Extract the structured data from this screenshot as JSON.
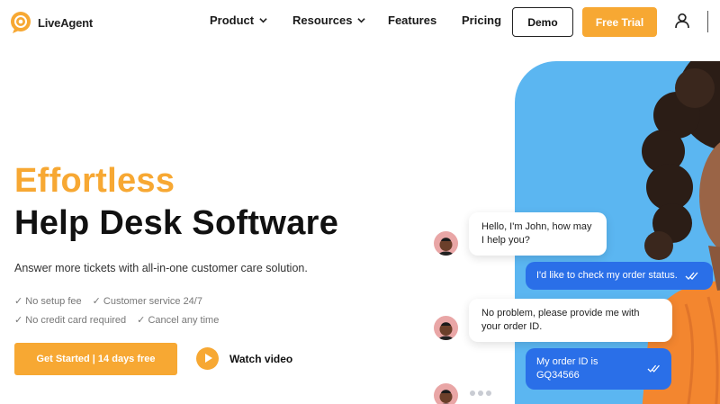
{
  "header": {
    "logo_text": "LiveAgent",
    "nav": [
      {
        "label": "Product",
        "has_dropdown": true
      },
      {
        "label": "Resources",
        "has_dropdown": true
      },
      {
        "label": "Features",
        "has_dropdown": false
      },
      {
        "label": "Pricing",
        "has_dropdown": false
      }
    ],
    "demo_label": "Demo",
    "trial_label": "Free Trial"
  },
  "hero": {
    "title_line1": "Effortless",
    "title_line2": "Help Desk Software",
    "subtitle": "Answer more tickets with all-in-one customer care solution.",
    "checks": [
      "✓ No setup fee",
      "✓ Customer service 24/7",
      "✓ No credit card required",
      "✓ Cancel any time"
    ],
    "cta_label": "Get Started | 14 days free",
    "watch_label": "Watch video"
  },
  "chat": {
    "messages": [
      {
        "from": "agent",
        "text": "Hello, I'm John, how may I help you?"
      },
      {
        "from": "customer",
        "text": "I'd like to check my order status."
      },
      {
        "from": "agent",
        "text": "No problem, please provide me with your order ID."
      },
      {
        "from": "customer",
        "text": "My order ID is GQ34566"
      }
    ]
  },
  "colors": {
    "accent": "#f7a833",
    "panel": "#5bb6f1",
    "customer_bubble": "#2a6fe8"
  }
}
